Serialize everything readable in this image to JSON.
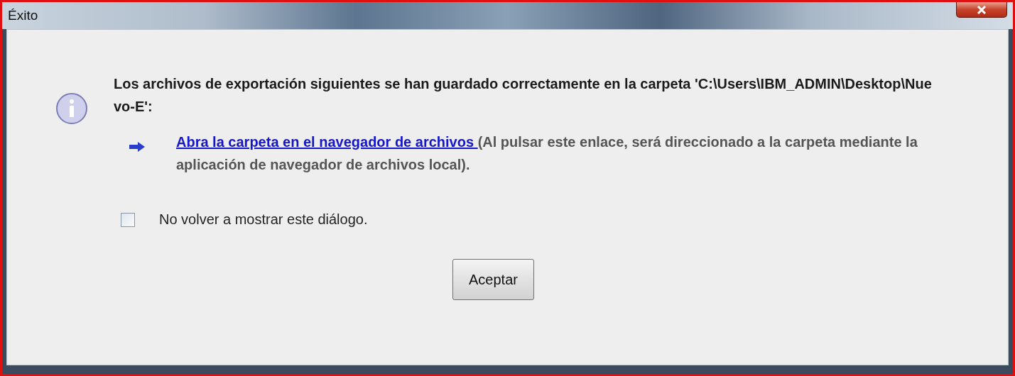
{
  "window": {
    "title": "Éxito"
  },
  "message": "Los archivos de exportación siguientes se han guardado correctamente en la carpeta 'C:\\Users\\IBM_ADMIN\\Desktop\\Nuevo-E':",
  "link": {
    "label": "Abra la carpeta en el navegador de archivos ",
    "note": "(Al pulsar este enlace, será direccionado a la carpeta mediante la aplicación de navegador de archivos local)."
  },
  "checkbox": {
    "label": "No volver a mostrar este diálogo.",
    "checked": false
  },
  "buttons": [
    "Aceptar"
  ]
}
